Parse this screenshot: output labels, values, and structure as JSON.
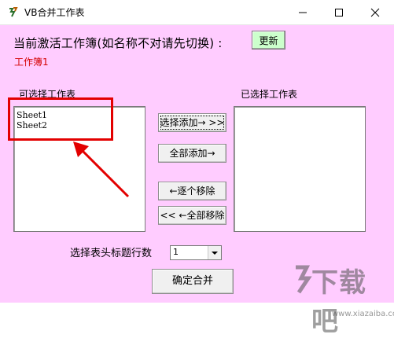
{
  "window": {
    "title": "VB合并工作表",
    "icon": "app-icon"
  },
  "header": {
    "prompt": "当前激活工作簿(如名称不对请先切换) :",
    "refresh_label": "更新",
    "workbook_name": "工作簿1"
  },
  "left_list": {
    "label": "可选择工作表",
    "items": [
      "Sheet1",
      "Sheet2"
    ]
  },
  "right_list": {
    "label": "已选择工作表",
    "items": []
  },
  "buttons": {
    "add_selected": "选择添加→ >>",
    "add_all": "全部添加→",
    "remove_one": "←逐个移除",
    "remove_all": "<< ←全部移除",
    "confirm": "确定合并"
  },
  "header_rows": {
    "label": "选择表头标题行数",
    "value": "1"
  },
  "watermark": {
    "main": "下载吧",
    "sub": "www.xiazaiba.com"
  },
  "colors": {
    "client_bg": "#ffccff",
    "refresh_bg": "#ccffcc",
    "workbook_name": "#d40000",
    "annotation": "#e30000"
  }
}
